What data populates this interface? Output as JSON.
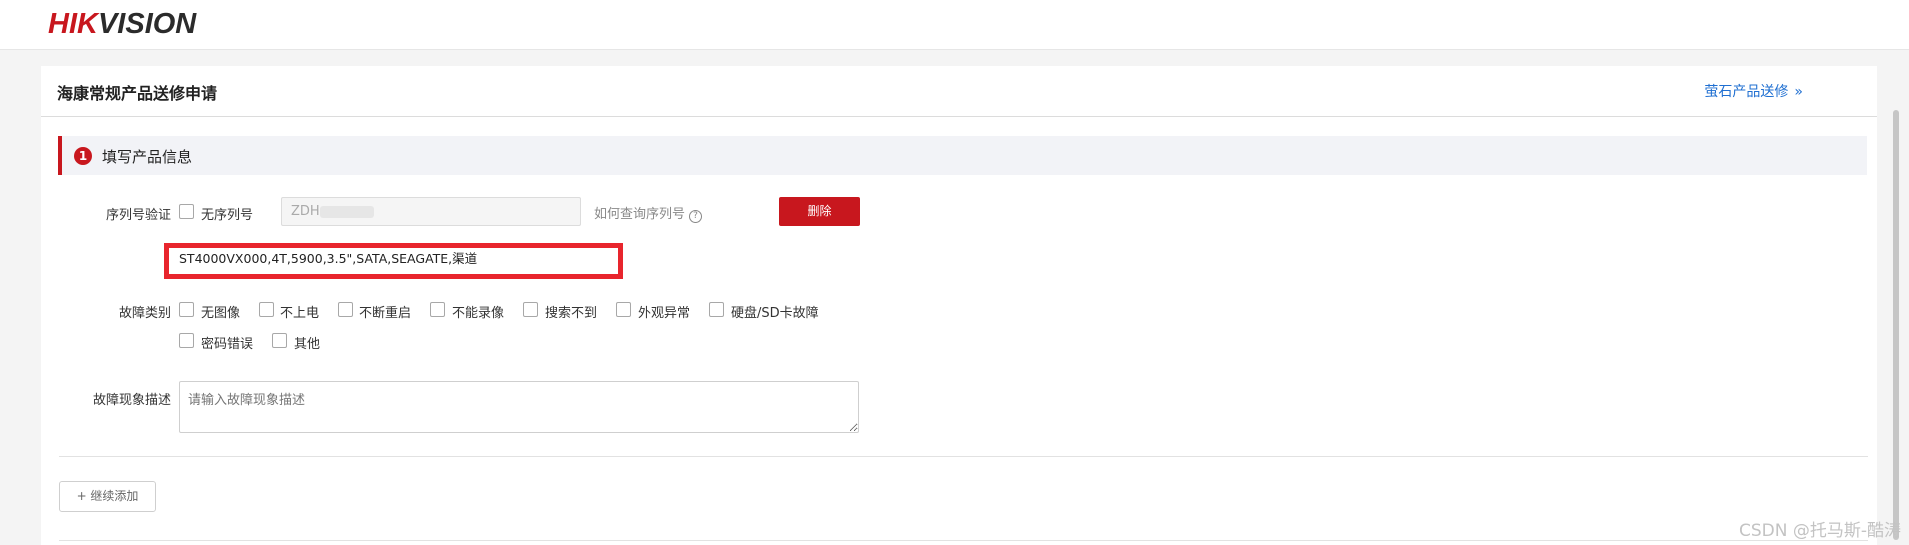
{
  "brand": {
    "logo_text_red": "HIK",
    "logo_text_dark": "VISION"
  },
  "header": {
    "title": "海康常规产品送修申请",
    "link_label": "萤石产品送修",
    "link_icon": "double-chevron-right-icon"
  },
  "section": {
    "step_number": "1",
    "title": "填写产品信息"
  },
  "serial": {
    "label": "序列号验证",
    "no_serial_label": "无序列号",
    "input_value": "ZDH",
    "help_text": "如何查询序列号",
    "delete_label": "删除",
    "product_info": "ST4000VX000,4T,5900,3.5\",SATA,SEAGATE,渠道"
  },
  "fault": {
    "label": "故障类别",
    "options": [
      "无图像",
      "不上电",
      "不断重启",
      "不能录像",
      "搜索不到",
      "外观异常",
      "硬盘/SD卡故障",
      "密码错误",
      "其他"
    ]
  },
  "description": {
    "label": "故障现象描述",
    "placeholder": "请输入故障现象描述"
  },
  "actions": {
    "add_more_label": "+ 继续添加"
  },
  "watermark": "CSDN @托马斯-酷涛",
  "colors": {
    "brand_red": "#c8171e",
    "link_blue": "#1f6fd1",
    "highlight_red": "#e8252d"
  }
}
